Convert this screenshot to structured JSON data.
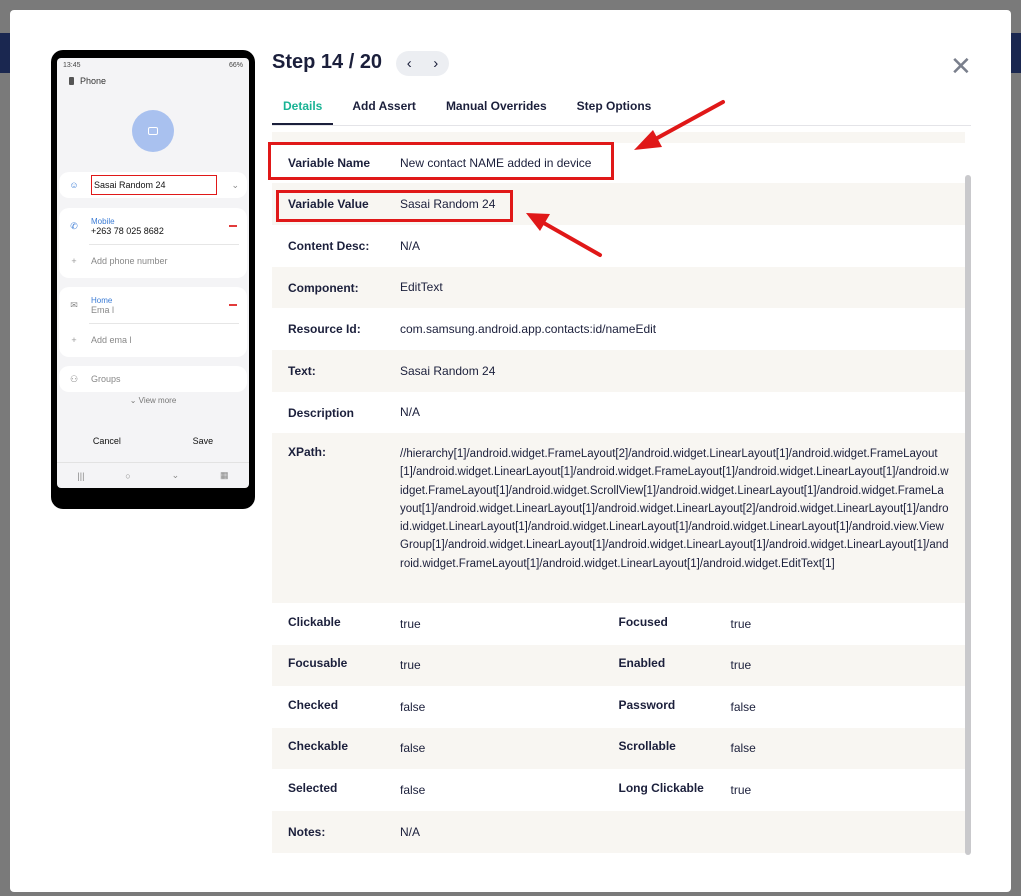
{
  "phone": {
    "status_time": "13:45",
    "status_right": "66%",
    "app_title": "Phone",
    "name_value": "Sasai Random 24",
    "mobile_label": "Mobile",
    "phone_number": "+263 78 025 8682",
    "add_phone": "Add phone number",
    "email_label": "Home",
    "email_placeholder": "Ema l",
    "add_email": "Add ema l",
    "groups": "Groups",
    "view_more": "View more",
    "cancel": "Cancel",
    "save": "Save"
  },
  "header": {
    "step_title": "Step 14 / 20",
    "prev_icon": "‹",
    "next_icon": "›",
    "close_icon": "✕"
  },
  "tabs": [
    {
      "label": "Details"
    },
    {
      "label": "Add Assert"
    },
    {
      "label": "Manual Overrides"
    },
    {
      "label": "Step Options"
    }
  ],
  "details": {
    "variable_name_label": "Variable Name",
    "variable_name_value": "New contact NAME added in device",
    "variable_value_label": "Variable Value",
    "variable_value_value": "Sasai Random 24",
    "content_desc_label": "Content Desc:",
    "content_desc_value": "N/A",
    "component_label": "Component:",
    "component_value": "EditText",
    "resource_id_label": "Resource Id:",
    "resource_id_value": "com.samsung.android.app.contacts:id/nameEdit",
    "text_label": "Text:",
    "text_value": "Sasai Random 24",
    "description_label": "Description",
    "description_value": "N/A",
    "xpath_label": "XPath:",
    "xpath_value": "//hierarchy[1]/android.widget.FrameLayout[2]/android.widget.LinearLayout[1]/android.widget.FrameLayout[1]/android.widget.LinearLayout[1]/android.widget.FrameLayout[1]/android.widget.LinearLayout[1]/android.widget.FrameLayout[1]/android.widget.ScrollView[1]/android.widget.LinearLayout[1]/android.widget.FrameLayout[1]/android.widget.LinearLayout[1]/android.widget.LinearLayout[2]/android.widget.LinearLayout[1]/android.widget.LinearLayout[1]/android.widget.LinearLayout[1]/android.widget.LinearLayout[1]/android.view.ViewGroup[1]/android.widget.LinearLayout[1]/android.widget.LinearLayout[1]/android.widget.LinearLayout[1]/android.widget.FrameLayout[1]/android.widget.LinearLayout[1]/android.widget.EditText[1]",
    "clickable_label": "Clickable",
    "clickable_value": "true",
    "focused_label": "Focused",
    "focused_value": "true",
    "focusable_label": "Focusable",
    "focusable_value": "true",
    "enabled_label": "Enabled",
    "enabled_value": "true",
    "checked_label": "Checked",
    "checked_value": "false",
    "password_label": "Password",
    "password_value": "false",
    "checkable_label": "Checkable",
    "checkable_value": "false",
    "scrollable_label": "Scrollable",
    "scrollable_value": "false",
    "selected_label": "Selected",
    "selected_value": "false",
    "long_clickable_label": "Long Clickable",
    "long_clickable_value": "true",
    "notes_label": "Notes:",
    "notes_value": "N/A"
  },
  "colors": {
    "accent_tab": "#19b394",
    "highlight": "#e01818",
    "title": "#1b1f3b"
  }
}
